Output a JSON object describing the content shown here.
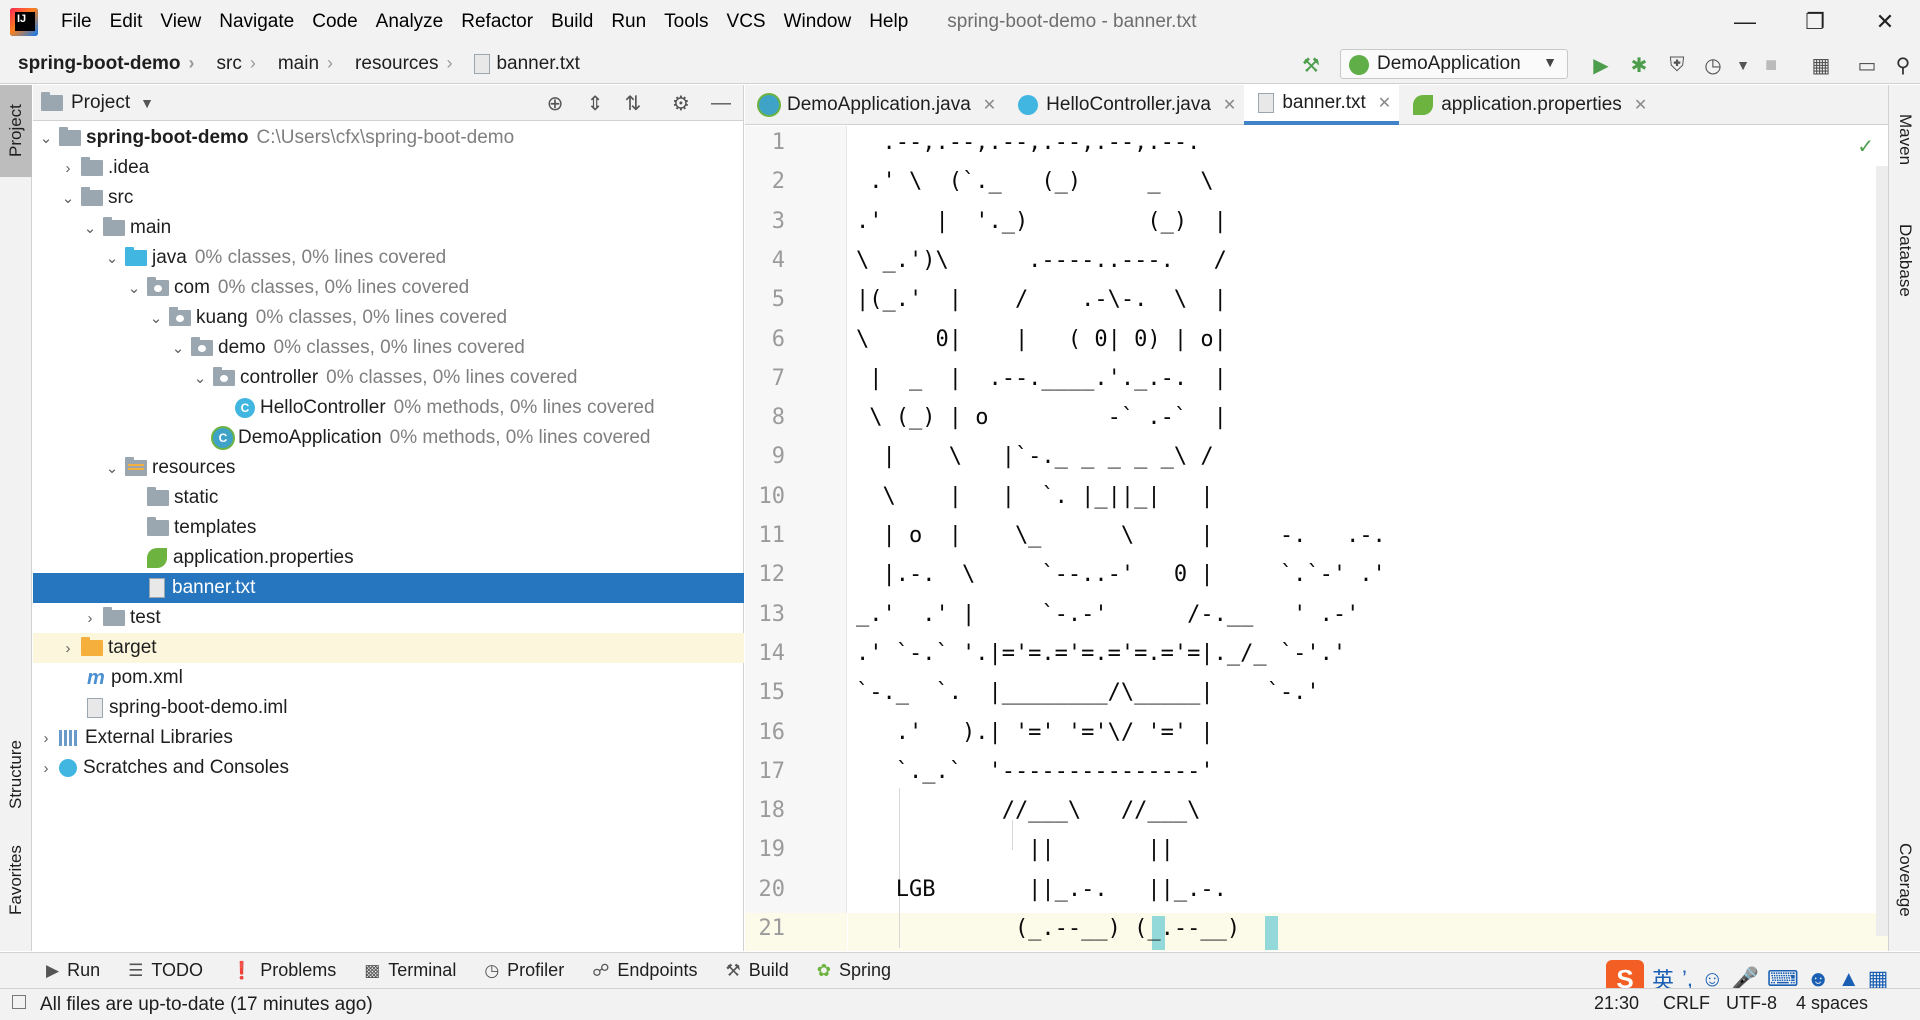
{
  "menubar": {
    "items": [
      "File",
      "Edit",
      "View",
      "Navigate",
      "Code",
      "Analyze",
      "Refactor",
      "Build",
      "Run",
      "Tools",
      "VCS",
      "Window",
      "Help"
    ],
    "window_title": "spring-boot-demo - banner.txt"
  },
  "navbar": {
    "breadcrumbs": [
      "spring-boot-demo",
      "src",
      "main",
      "resources",
      "banner.txt"
    ],
    "run_config": "DemoApplication"
  },
  "left_stripe": {
    "project": "Project",
    "structure": "Structure",
    "favorites": "Favorites"
  },
  "right_stripe": {
    "maven": "Maven",
    "database": "Database",
    "coverage": "Coverage"
  },
  "project_panel": {
    "title": "Project",
    "tree": [
      {
        "name": "spring-boot-demo",
        "extra": "C:\\Users\\cfx\\spring-boot-demo"
      },
      {
        "name": ".idea",
        "extra": ""
      },
      {
        "name": "src",
        "extra": ""
      },
      {
        "name": "main",
        "extra": ""
      },
      {
        "name": "java",
        "extra": "0% classes, 0% lines covered"
      },
      {
        "name": "com",
        "extra": "0% classes, 0% lines covered"
      },
      {
        "name": "kuang",
        "extra": "0% classes, 0% lines covered"
      },
      {
        "name": "demo",
        "extra": "0% classes, 0% lines covered"
      },
      {
        "name": "controller",
        "extra": "0% classes, 0% lines covered"
      },
      {
        "name": "HelloController",
        "extra": "0% methods, 0% lines covered"
      },
      {
        "name": "DemoApplication",
        "extra": "0% methods, 0% lines covered"
      },
      {
        "name": "resources",
        "extra": ""
      },
      {
        "name": "static",
        "extra": ""
      },
      {
        "name": "templates",
        "extra": ""
      },
      {
        "name": "application.properties",
        "extra": ""
      },
      {
        "name": "banner.txt",
        "extra": ""
      },
      {
        "name": "test",
        "extra": ""
      },
      {
        "name": "target",
        "extra": ""
      },
      {
        "name": "pom.xml",
        "extra": ""
      },
      {
        "name": "spring-boot-demo.iml",
        "extra": ""
      },
      {
        "name": "External Libraries",
        "extra": ""
      },
      {
        "name": "Scratches and Consoles",
        "extra": ""
      }
    ]
  },
  "editor": {
    "tabs": [
      "DemoApplication.java",
      "HelloController.java",
      "banner.txt",
      "application.properties"
    ],
    "active_tab": "banner.txt",
    "lines": [
      "  .--,.--,.--,.--,.--,.--.",
      " .' \\  (`._   (_)     _   \\",
      ".'    |  '._)         (_)  |",
      "\\ _.')\\      .----..---.   /",
      "|(_.'  |    /    .-\\-.  \\  |",
      "\\     0|    |   ( 0| 0) | o|",
      " |  _  |  .--.____.'._.-.  |",
      " \\ (_) | o         -` .-`  |",
      "  |    \\   |`-._ _ _ _ _\\ /",
      "  \\    |   |  `. |_||_|   |",
      "  | o  |    \\_      \\     |     -.   .-.",
      "  |.-.  \\     `--..-'   0 |     `.`-' .'",
      "_.'  .' |     `-.-'      /-.__   ' .-'",
      ".' `-.` '.|='=.='=.='=.='=|._/_ `-'.'",
      "`-._  `.  |________/\\_____|    `-.'",
      "   .'   ).| '=' '='\\/ '=' |",
      "   `._.`  '---------------'",
      "           //___\\   //___\\",
      "             ||       ||",
      "   LGB       ||_.-.   ||_.-.",
      "            (_.--__) (_.--__)"
    ]
  },
  "bottom_tools": [
    "Run",
    "TODO",
    "Problems",
    "Terminal",
    "Profiler",
    "Endpoints",
    "Build",
    "Spring"
  ],
  "status": {
    "message": "All files are up-to-date (17 minutes ago)",
    "position": "21:30",
    "line_sep": "CRLF",
    "encoding": "UTF-8",
    "indent": "4 spaces"
  },
  "ime": {
    "logo": "S",
    "lang": "英"
  },
  "colors": {
    "selection": "#2675bf",
    "accent_tab": "#4083c9",
    "brace_highlight": "#93d9d9"
  }
}
